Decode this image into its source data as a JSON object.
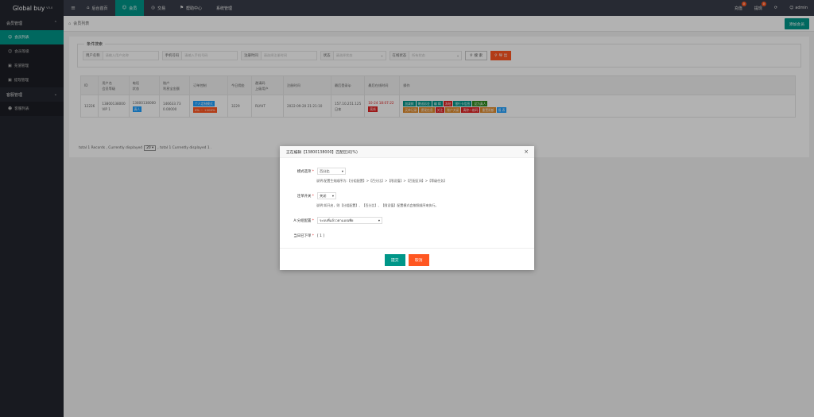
{
  "header": {
    "logo": "Global buy",
    "logo_sup": "V3.0",
    "nav": [
      {
        "label": "后台首页",
        "icon": "⌂"
      },
      {
        "label": "会员",
        "icon": "👤"
      },
      {
        "label": "交易",
        "icon": "◎"
      },
      {
        "label": "帮助中心",
        "icon": "⚑"
      },
      {
        "label": "系统管理",
        "icon": ""
      }
    ],
    "right": {
      "recharge": "充值",
      "recharge_badge": "0",
      "withdraw": "提现",
      "withdraw_badge": "0",
      "refresh_icon": "⟳",
      "user": "admin"
    }
  },
  "sidebar": {
    "group1": "会员管理",
    "items1": [
      "会员列表",
      "会员等级",
      "充值管理",
      "提现管理"
    ],
    "group2": "客服管理",
    "items2": [
      "客服列表"
    ]
  },
  "main": {
    "breadcrumb": "会员列表",
    "add_button": "添加会员",
    "search": {
      "legend": "条件搜索",
      "username_label": "用户名称",
      "username_placeholder": "请输入用户名称",
      "phone_label": "手机号码",
      "phone_placeholder": "请输入手机号码",
      "regtime_label": "注册时间",
      "regtime_placeholder": "请选择注册时间",
      "status_label": "状态",
      "status_value": "请选择状态",
      "online_label": "在线状态",
      "online_value": "所有状态",
      "search_button": "搜 索",
      "export_button": "导 出"
    },
    "table": {
      "headers": [
        "ID",
        "用户名\n会员等级",
        "电话\n状态",
        "账户\n利息宝金额",
        "订单控制",
        "今日佣金",
        "邀请码\n上级用户",
        "注册时间",
        "最后登录ip",
        "最后在线时间",
        "操作"
      ],
      "row": {
        "id": "12226",
        "username": "13800138000",
        "level": "VIP 1",
        "phone": "13800138000",
        "status": "真人",
        "balance": "146633.73",
        "interest": "0.00000",
        "order_tag1": "个人定制模式",
        "order_tag2": "0% ~ +200%",
        "commission": "3229",
        "invite": "RLYHT",
        "parent": "",
        "regtime": "2022-09-20 21:21:10",
        "ip": "157.10.251.125",
        "ip_loc": "日本",
        "last_online": "10-24 18:07:22",
        "online_tag": "离线",
        "ops_row1": [
          "加减款",
          "赠送彩金",
          "编 辑",
          "冻结",
          "银行卡信息",
          "设为真人"
        ],
        "ops_row2": [
          "买单记录",
          "提现信息",
          "关注",
          "账户关闭",
          "清除二维码",
          "重置限额",
          "报 表"
        ]
      }
    },
    "pager": {
      "text1": "total 1 Records , Currently displayed",
      "page_size": "20",
      "text2": ", total 1 Currently displayed 1 ."
    }
  },
  "modal": {
    "title": "正在编辑【13800138000】匹配区间(%)",
    "close_icon": "×",
    "mode_label": "模式选项",
    "mode_value": "百分比",
    "mode_desc": "说明:配置生效顺序为:【分组配置】>【百分比】>【限设值】>【匹配区间】>【等级任务】",
    "switch_label": "连单开关",
    "switch_value": "关闭",
    "switch_desc": "说明:如开启，则【分组配置】、【百分比】、【限设值】配置模式会按照顺序来执行。",
    "group_label": "A:分组配置",
    "group_value": "ระบบที่เเล้ววตาเเอปเพีย",
    "today_label": "当日已下单",
    "today_value": "[ 1 ]",
    "submit": "提交",
    "cancel": "取消"
  },
  "colors": {
    "accent": "#009688",
    "danger": "#ff5722",
    "topbar": "#393d49",
    "sidebar": "#23262e"
  }
}
